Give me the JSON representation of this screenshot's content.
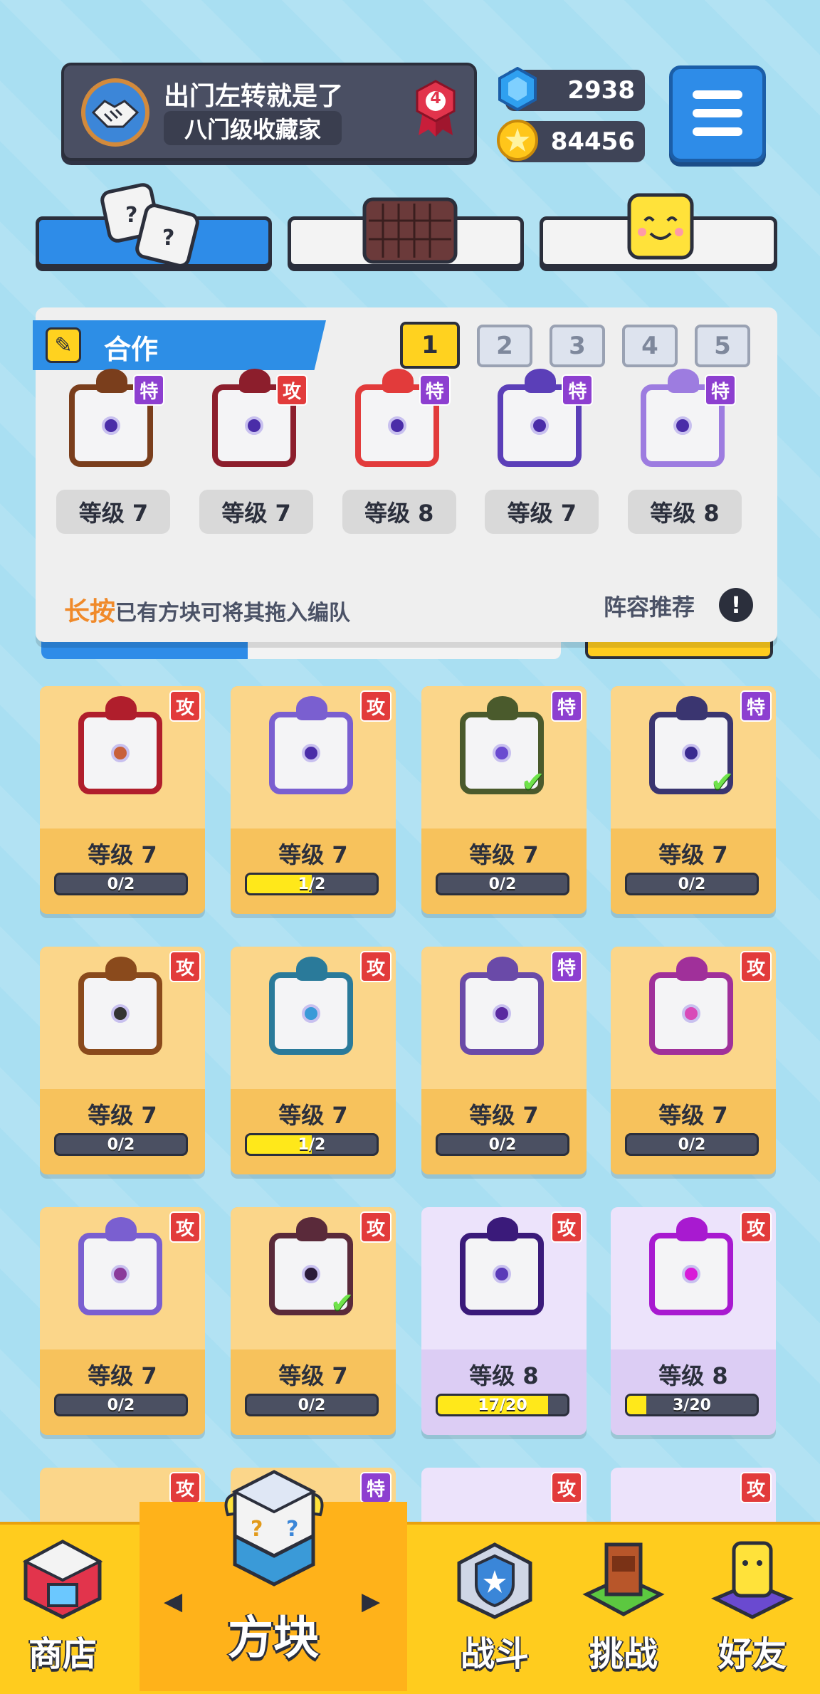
{
  "header": {
    "player_name": "出门左转就是了",
    "player_title": "八门级收藏家",
    "rank": "4",
    "gems": "2938",
    "coins": "84456"
  },
  "deck": {
    "tab_label": "合作",
    "pages": [
      "1",
      "2",
      "3",
      "4",
      "5"
    ],
    "selected_page": "1",
    "slots": [
      {
        "tag": "特",
        "level": "等级 7",
        "frame": "#7a3e1c"
      },
      {
        "tag": "攻",
        "level": "等级 7",
        "frame": "#8c1e2c"
      },
      {
        "tag": "特",
        "level": "等级 8",
        "frame": "#e23b3b"
      },
      {
        "tag": "特",
        "level": "等级 7",
        "frame": "#5b3fb8"
      },
      {
        "tag": "特",
        "level": "等级 8",
        "frame": "#9d7ce0"
      }
    ],
    "hint_bold": "长按",
    "hint_text": "已有方块可将其拖入编队",
    "recommend_label": "阵容推荐",
    "recommend_icon": "!"
  },
  "inventory": [
    {
      "tag": "攻",
      "level": "等级 7",
      "progress": "0/2",
      "fill": 0.0,
      "rarity": "gold",
      "frame": "#b01e2c",
      "pip": "#c8603a",
      "checked": false
    },
    {
      "tag": "攻",
      "level": "等级 7",
      "progress": "1/2",
      "fill": 0.5,
      "rarity": "gold",
      "frame": "#7a5fd0",
      "pip": "#4a2da8",
      "checked": false
    },
    {
      "tag": "特",
      "level": "等级 7",
      "progress": "0/2",
      "fill": 0.0,
      "rarity": "gold",
      "frame": "#4a5a2c",
      "pip": "#6a4ad0",
      "checked": true
    },
    {
      "tag": "特",
      "level": "等级 7",
      "progress": "0/2",
      "fill": 0.0,
      "rarity": "gold",
      "frame": "#3a3570",
      "pip": "#3a2a90",
      "checked": true
    },
    {
      "tag": "攻",
      "level": "等级 7",
      "progress": "0/2",
      "fill": 0.0,
      "rarity": "gold",
      "frame": "#8a4a1c",
      "pip": "#333333",
      "checked": false
    },
    {
      "tag": "攻",
      "level": "等级 7",
      "progress": "1/2",
      "fill": 0.5,
      "rarity": "gold",
      "frame": "#2a7a9a",
      "pip": "#3a9ad8",
      "checked": false
    },
    {
      "tag": "特",
      "level": "等级 7",
      "progress": "0/2",
      "fill": 0.0,
      "rarity": "gold",
      "frame": "#6a4aa8",
      "pip": "#5a2aa0",
      "checked": false
    },
    {
      "tag": "攻",
      "level": "等级 7",
      "progress": "0/2",
      "fill": 0.0,
      "rarity": "gold",
      "frame": "#a0309a",
      "pip": "#d84ab8",
      "checked": false
    },
    {
      "tag": "攻",
      "level": "等级 7",
      "progress": "0/2",
      "fill": 0.0,
      "rarity": "gold",
      "frame": "#7a5fd0",
      "pip": "#8a3a9a",
      "checked": false
    },
    {
      "tag": "攻",
      "level": "等级 7",
      "progress": "0/2",
      "fill": 0.0,
      "rarity": "gold",
      "frame": "#5a2a3a",
      "pip": "#2a1a3a",
      "checked": true
    },
    {
      "tag": "攻",
      "level": "等级 8",
      "progress": "17/20",
      "fill": 0.85,
      "rarity": "purple",
      "frame": "#3a1a7a",
      "pip": "#5a3ab8",
      "checked": false
    },
    {
      "tag": "攻",
      "level": "等级 8",
      "progress": "3/20",
      "fill": 0.15,
      "rarity": "purple",
      "frame": "#a81ad0",
      "pip": "#d81ad8",
      "checked": false
    }
  ],
  "peek_tags": [
    "攻",
    "特",
    "攻",
    "攻"
  ],
  "nav": {
    "shop": "商店",
    "blocks": "方块",
    "battle": "战斗",
    "challenge": "挑战",
    "friends": "好友",
    "prev_arrow": "◀",
    "next_arrow": "▶"
  }
}
